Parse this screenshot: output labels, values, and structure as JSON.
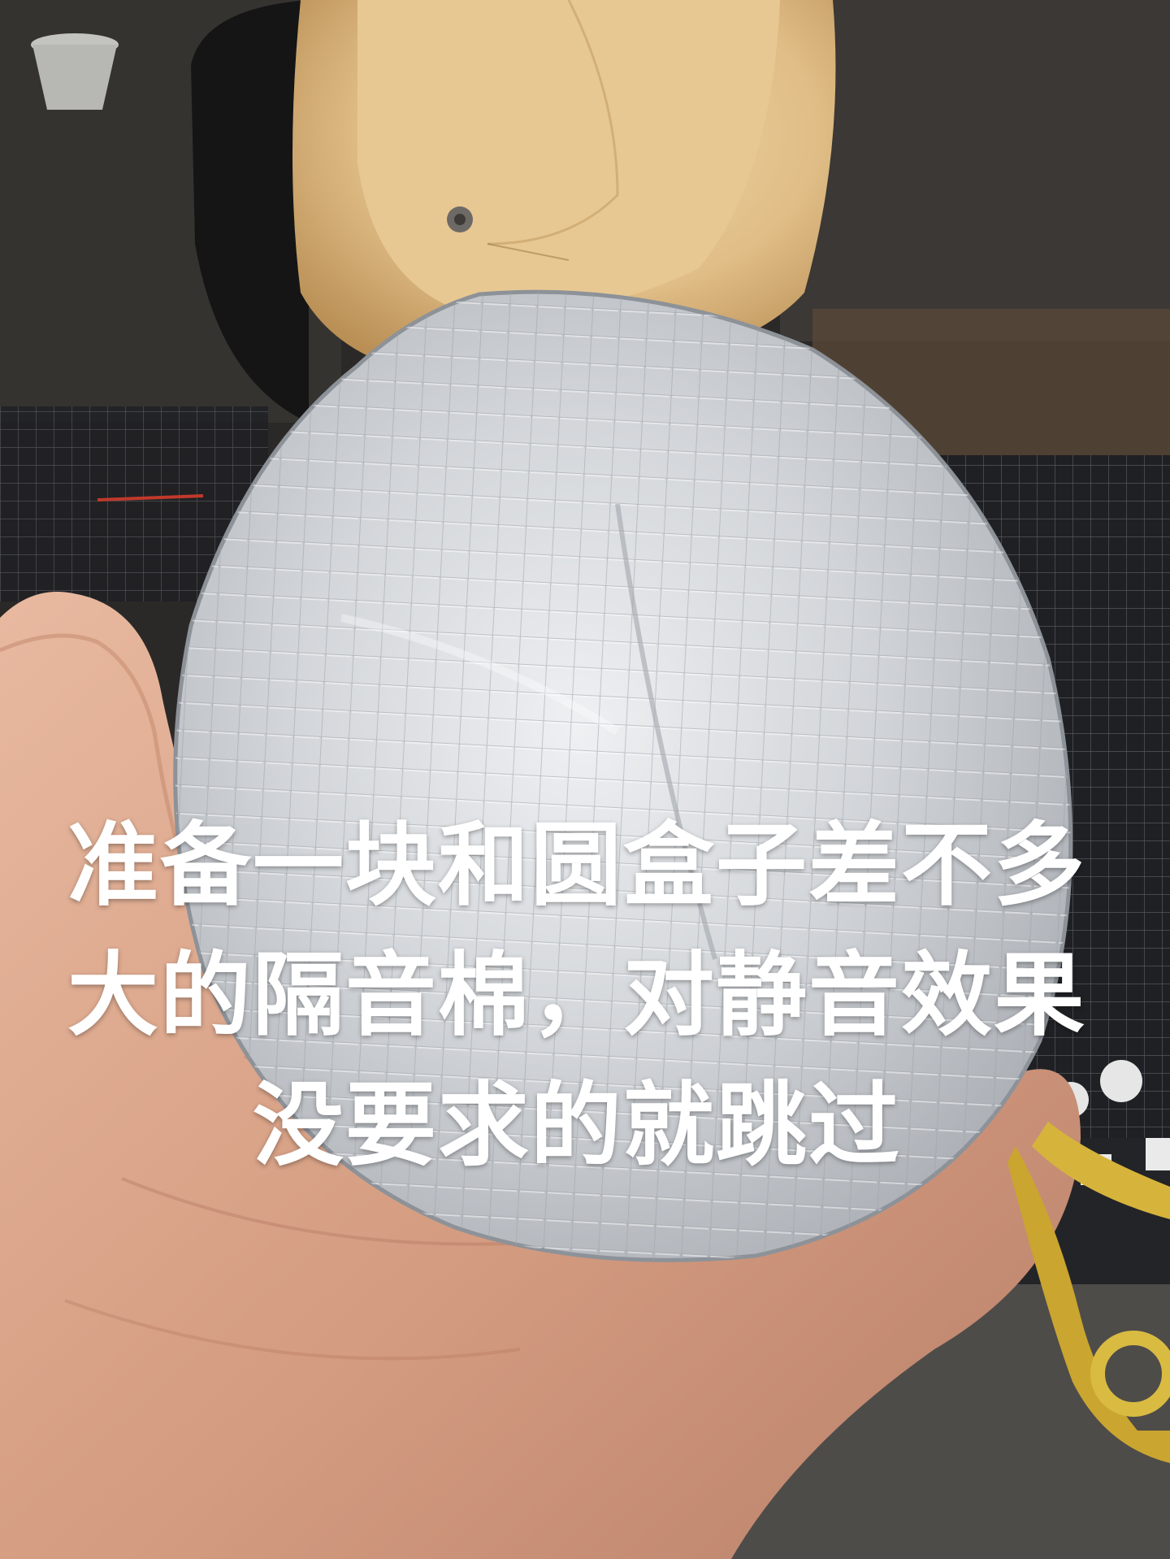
{
  "photo": {
    "subject": "round-sound-insulation-foam-in-hand",
    "colors": {
      "background": "#2a2826",
      "wood": "#e3c28f",
      "foil": "#c9ccd0",
      "skin": "#d9a489",
      "cutting_mat": "#1e1f22",
      "scissors": "#d4b43a"
    }
  },
  "caption": {
    "lines": [
      "准备一块和圆盒子差不多",
      "大的隔音棉，对静音效果",
      "没要求的就跳过"
    ],
    "color": "#ffffff"
  }
}
